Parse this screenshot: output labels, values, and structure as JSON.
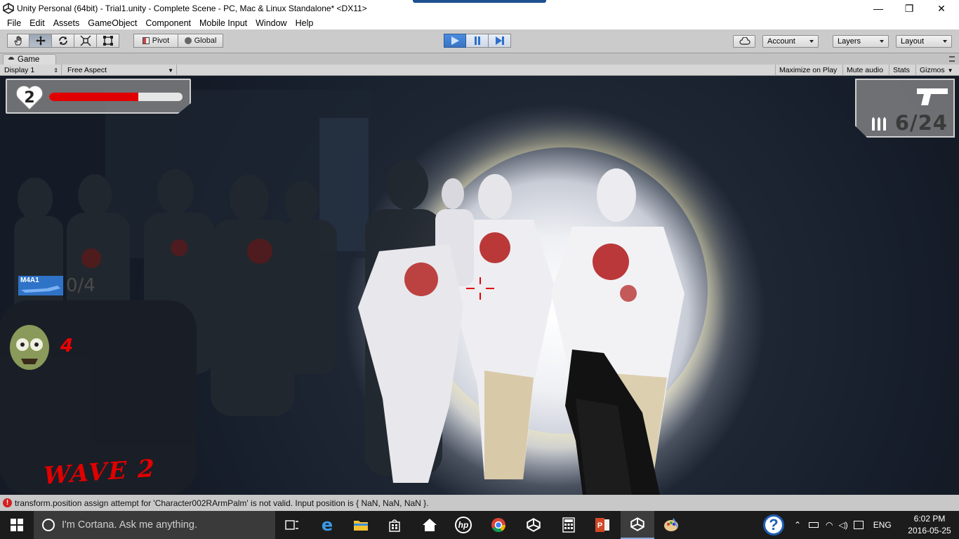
{
  "window": {
    "title": "Unity Personal (64bit) - Trial1.unity - Complete Scene - PC, Mac & Linux Standalone* <DX11>",
    "minimize": "—",
    "maximize": "❐",
    "close": "✕"
  },
  "menu": [
    "File",
    "Edit",
    "Assets",
    "GameObject",
    "Component",
    "Mobile Input",
    "Window",
    "Help"
  ],
  "toolbar": {
    "pivot_label": "Pivot",
    "global_label": "Global",
    "account_label": "Account",
    "layers_label": "Layers",
    "layout_label": "Layout"
  },
  "game_tab": {
    "title": "Game",
    "display": "Display 1",
    "aspect": "Free Aspect",
    "maximize_on_play": "Maximize on Play",
    "mute_audio": "Mute audio",
    "stats": "Stats",
    "gizmos": "Gizmos"
  },
  "hud": {
    "lives": "2",
    "health_fraction": 0.67,
    "ammo": "6/24",
    "weapon_name": "M4A1",
    "weapon_count": "0/4",
    "kills": "4",
    "wave": "WAVE 2"
  },
  "console": {
    "message": "transform.position assign attempt for 'Character002RArmPalm' is not valid. Input position is { NaN, NaN, NaN }."
  },
  "taskbar": {
    "cortana_placeholder": "I'm Cortana. Ask me anything.",
    "language": "ENG",
    "time": "6:02 PM",
    "date": "2016-05-25"
  },
  "colors": {
    "health": "#e00000",
    "wave": "#e00000",
    "error": "#d42020"
  }
}
